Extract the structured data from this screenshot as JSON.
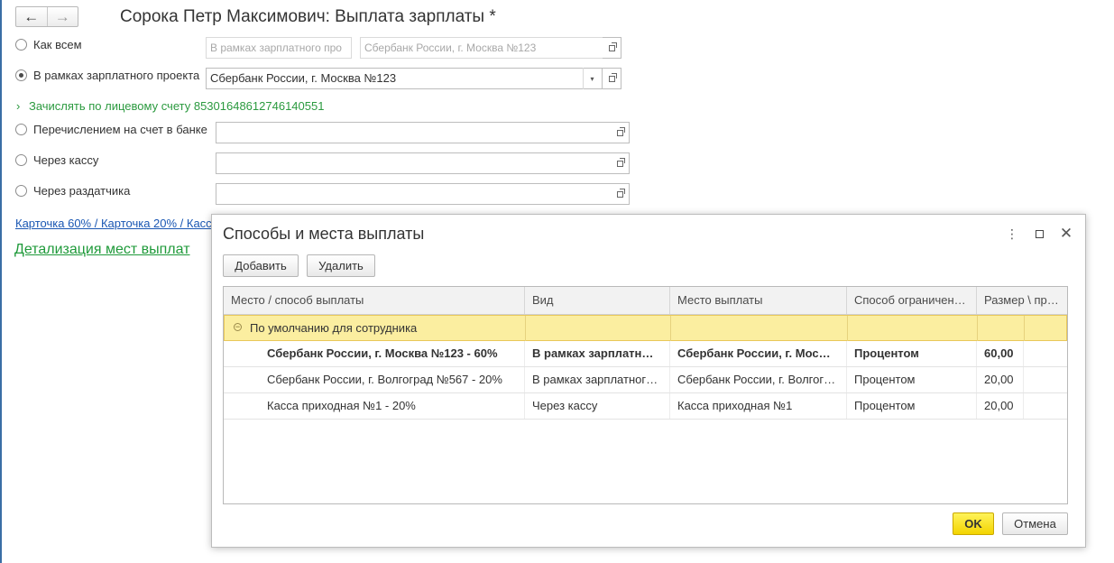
{
  "window": {
    "title": "Сорока Петр Максимович: Выплата зарплаты *"
  },
  "options": {
    "like_all": {
      "label": "Как всем",
      "project_placeholder": "В рамках зарплатного про",
      "bank_value": "Сбербанк России, г. Москва №123"
    },
    "salary_project": {
      "label": "В рамках зарплатного проекта",
      "value": "Сбербанк России, г. Москва №123"
    },
    "account_link": "Зачислять по лицевому счету 85301648612746140551",
    "bank_transfer": {
      "label": "Перечислением на счет в банке",
      "value": ""
    },
    "cashbox": {
      "label": "Через кассу",
      "value": ""
    },
    "distributor": {
      "label": "Через раздатчика",
      "value": ""
    }
  },
  "summary_link": "Карточка 60% / Карточка 20% / Касс",
  "detail_link": "Детализация мест выплат",
  "dialog": {
    "title": "Способы и места выплаты",
    "add_label": "Добавить",
    "delete_label": "Удалить",
    "ok_label": "OK",
    "cancel_label": "Отмена",
    "columns": [
      "Место / способ выплаты",
      "Вид",
      "Место выплаты",
      "Способ ограничен…",
      "Размер \\ пр…"
    ],
    "group_row": "По умолчанию для сотрудника",
    "rows": [
      {
        "place": "Сбербанк России, г. Москва №123 - 60%",
        "kind": "В рамках зарплатн…",
        "location": "Сбербанк России, г. Мос…",
        "method": "Процентом",
        "size": "60,00"
      },
      {
        "place": "Сбербанк России, г. Волгоград №567 - 20%",
        "kind": "В рамках зарплатног…",
        "location": "Сбербанк России, г. Волгог…",
        "method": "Процентом",
        "size": "20,00"
      },
      {
        "place": "Касса приходная №1 - 20%",
        "kind": "Через кассу",
        "location": "Касса приходная №1",
        "method": "Процентом",
        "size": "20,00"
      }
    ]
  },
  "icons": {
    "back": "arrow-left-icon",
    "forward": "arrow-right-icon",
    "open": "open-form-icon",
    "dropdown": "chevron-down-icon",
    "menu": "more-vertical-icon",
    "maximize": "maximize-icon",
    "close": "close-icon"
  }
}
